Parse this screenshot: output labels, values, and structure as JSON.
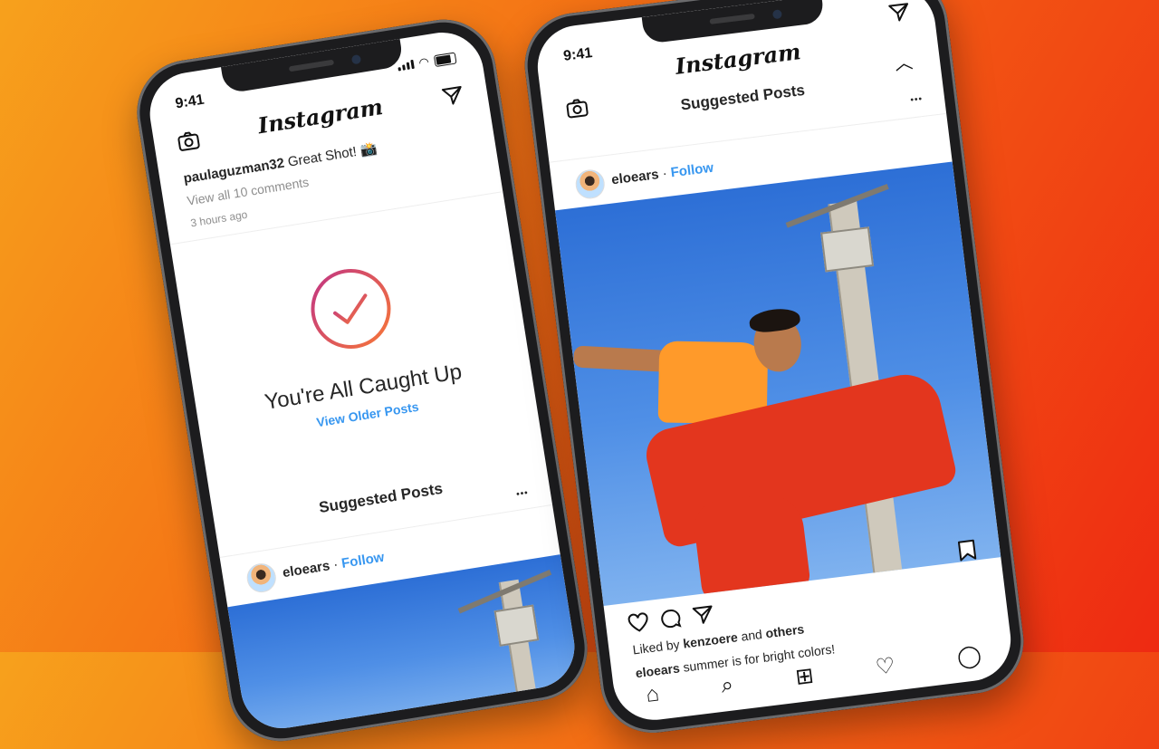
{
  "left_phone": {
    "status_time": "9:41",
    "app_title": "Instagram",
    "comment_user": "paulaguzman32",
    "comment_text": "Great Shot! 📸",
    "view_comments": "View all 10 comments",
    "timestamp": "3 hours ago",
    "caught_up_title": "You're All Caught Up",
    "view_older": "View Older Posts",
    "suggested_title": "Suggested Posts",
    "more": "•••",
    "post_user": "eloears",
    "sep": "·",
    "follow": "Follow"
  },
  "right_phone": {
    "status_time": "9:41",
    "app_title": "Instagram",
    "suggested_title": "Suggested Posts",
    "more": "•••",
    "post_user": "eloears",
    "sep": "·",
    "follow": "Follow",
    "liked_by_prefix": "Liked by",
    "liked_by_user": "kenzoere",
    "liked_by_and": "and",
    "liked_by_others": "others",
    "caption_user": "eloears",
    "caption_text": "summer is for bright colors!"
  },
  "icons": [
    "camera-icon",
    "direct-send-icon",
    "checkmark-ring-icon",
    "heart-icon",
    "comment-icon",
    "share-icon",
    "bookmark-icon",
    "home-icon",
    "search-icon",
    "add-icon",
    "activity-icon",
    "profile-icon",
    "chevron-up-icon"
  ],
  "colors": {
    "ig_blue": "#3897f0",
    "ring_start": "#c13584",
    "ring_end": "#f77737"
  }
}
